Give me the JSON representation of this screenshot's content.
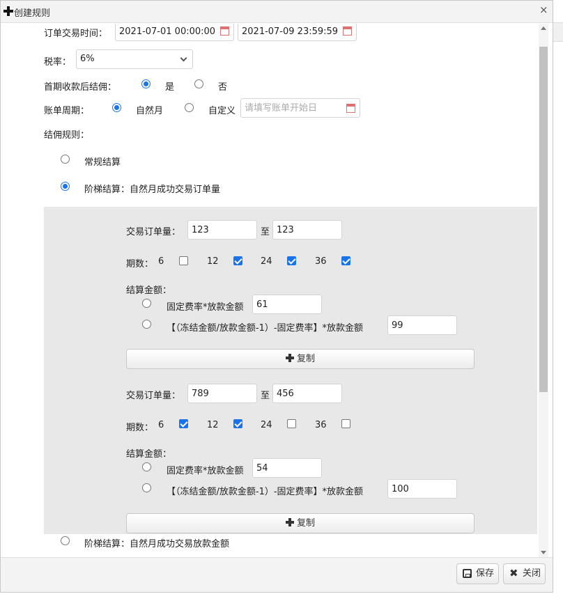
{
  "dialog": {
    "title": "创建规则",
    "close_glyph": "×"
  },
  "form": {
    "order_time_label": "订单交易时间：",
    "order_time_start": "2021-07-01 00:00:00",
    "order_time_end": "2021-07-09 23:59:59",
    "tax_label": "税率：",
    "tax_value": "6%",
    "first_payment_label": "首期收款后结佣：",
    "first_payment_yes": "是",
    "first_payment_no": "否",
    "first_payment_selected": "是",
    "bill_cycle_label": "账单周期：",
    "bill_cycle_natural": "自然月",
    "bill_cycle_custom": "自定义",
    "bill_cycle_selected": "自然月",
    "bill_start_placeholder": "请填写账单开始日",
    "commission_rule_label": "结佣规则：",
    "rule_regular": "常规结算",
    "rule_tier_orders": "阶梯结算：自然月成功交易订单量",
    "rule_tier_amount": "阶梯结算：自然月成功交易放款金额",
    "rule_selected": "阶梯结算：自然月成功交易订单量"
  },
  "tiers": [
    {
      "order_qty_label": "交易订单量：",
      "order_qty_from": "123",
      "to_label": "至",
      "order_qty_to": "123",
      "periods_label": "期数：",
      "periods": [
        {
          "label": "6",
          "checked": false
        },
        {
          "label": "12",
          "checked": true
        },
        {
          "label": "24",
          "checked": true
        },
        {
          "label": "36",
          "checked": true
        }
      ],
      "settle_label": "结算金额：",
      "fixed_rate_label": "固定费率*放款金额",
      "fixed_rate_value": "61",
      "formula_label": "【（冻结金额/放款金额-1）-固定费率】*放款金额",
      "formula_value": "99",
      "copy_label": "复制"
    },
    {
      "order_qty_label": "交易订单量：",
      "order_qty_from": "789",
      "to_label": "至",
      "order_qty_to": "456",
      "periods_label": "期数：",
      "periods": [
        {
          "label": "6",
          "checked": true
        },
        {
          "label": "12",
          "checked": true
        },
        {
          "label": "24",
          "checked": false
        },
        {
          "label": "36",
          "checked": false
        }
      ],
      "settle_label": "结算金额：",
      "fixed_rate_label": "固定费率*放款金额",
      "fixed_rate_value": "54",
      "formula_label": "【（冻结金额/放款金额-1）-固定费率】*放款金额",
      "formula_value": "100",
      "copy_label": "复制"
    }
  ],
  "footer": {
    "save_label": "保存",
    "close_label": "关闭"
  },
  "colors": {
    "accent": "#1a73e8",
    "panel_bg": "#e8e8e8",
    "titlebar_bg": "#f3f3f3"
  }
}
